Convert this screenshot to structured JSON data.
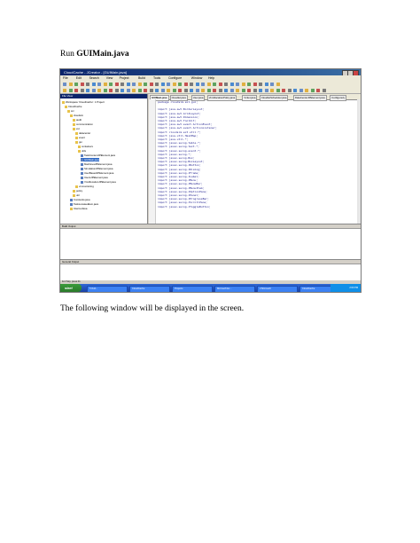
{
  "document": {
    "heading_prefix": "Run",
    "heading_file": "GUIMain.java",
    "caption": "The following window will be displayed in the screen."
  },
  "screenshot": {
    "window_title": "CloudCache - JCreator - [GUIMain.java]",
    "menu": [
      "File",
      "Edit",
      "Search",
      "View",
      "Project",
      "Build",
      "Tools",
      "Configure",
      "Window",
      "Help"
    ],
    "project_panel_title": "File View",
    "tree": [
      "Workspace 'CloudCache': 1 Project",
      "CloudCache",
      "src",
      "cloudsim",
      "audit",
      "communication",
      "ext",
      "datacenter",
      "event",
      "gui",
      "containers",
      "utils",
      "TaskContentJPElement.java",
      "GUIMain.java",
      "MachinesJPElement.java",
      "SimulationJPElement.java",
      "UserBasedJPElement.java",
      "UsersJPElement.java",
      "VmAllocationJPElement.java",
      "vmmonitoring",
      "policy",
      "util",
      "Constants.java",
      "TaskLocateeElem.java",
      "InternetJava"
    ],
    "selected_tree_item": "GUIMain.java",
    "tabs": [
      "GUIMain.java",
      "Cloudlet.java",
      "User.java",
      "VmAllocationPolicy.java",
      "Vmlet.java",
      "CloudletScheduler.java",
      "DataCenterJPElement.java",
      "Configured.j"
    ],
    "code_lines": [
      "package cloudsim.ext.gui;",
      "",
      "import java.awt.BorderLayout;",
      "import java.awt.GridLayout;",
      "import java.awt.Dimension;",
      "import java.awt.Toolkit;",
      "import java.awt.event.ActionEvent;",
      "import java.awt.event.ActionListener;",
      "import cloudsim.ext.util.*;",
      "import java.util.HashMap;",
      "import java.util.*;",
      "import javax.swing.table.*;",
      "import javax.swing.text.*;",
      "import javax.swing.event.*;",
      "import javax.swing.*;",
      "import javax.swing.Box;",
      "import javax.swing.BoxLayout;",
      "import javax.swing.JButton;",
      "import javax.swing.JDialog;",
      "import javax.swing.JFrame;",
      "import javax.swing.JLabel;",
      "import javax.swing.JMenu;",
      "import javax.swing.JMenuBar;",
      "import javax.swing.JMenuItem;",
      "import javax.swing.JOptionPane;",
      "import javax.swing.JPanel;",
      "import javax.swing.JProgressBar;",
      "import javax.swing.JScrollPane;",
      "import javax.swing.JToggleButton;"
    ],
    "build_output_title": "Build Output",
    "general_output_title": "General Output",
    "status_text": "For Help, press F1",
    "taskbar": {
      "start_label": "start",
      "tasks": [
        "5 Outl...",
        "CloudCache",
        "Projects",
        "Microsoft Ex...",
        "2 Microsoft",
        "CloudCache"
      ],
      "clock": "2:00 PM"
    }
  }
}
